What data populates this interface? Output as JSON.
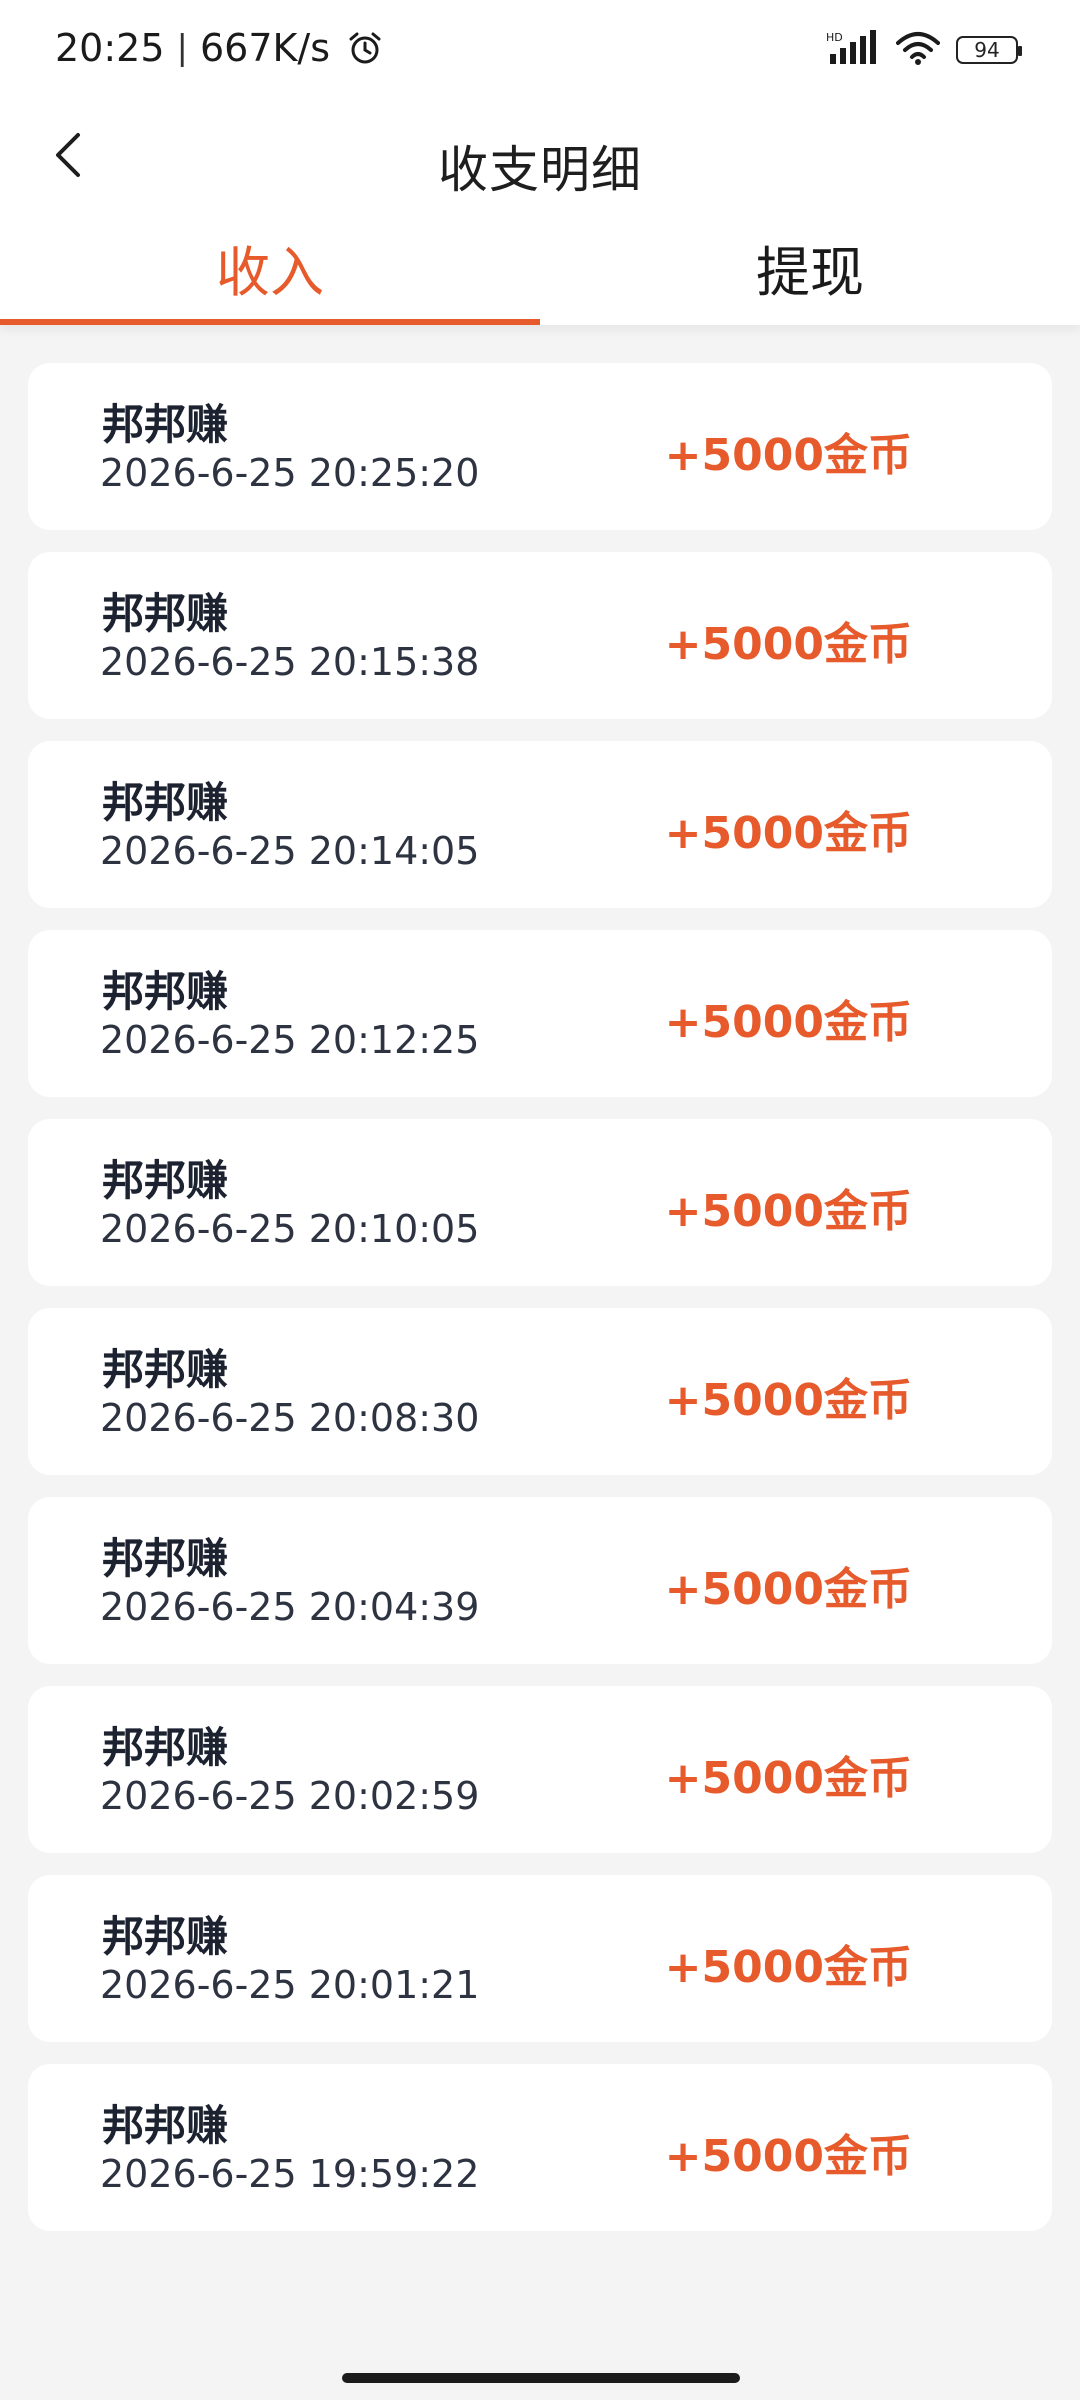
{
  "status_bar": {
    "time": "20:25",
    "separator": "|",
    "network_speed": "667K/s",
    "battery_level": "94",
    "alarm_icon": "alarm-clock-icon",
    "signal_icon": "signal-icon",
    "wifi_icon": "wifi-icon",
    "hd_label": "HD"
  },
  "header": {
    "title": "收支明细",
    "back_icon": "chevron-left-icon"
  },
  "tabs": [
    {
      "label": "收入",
      "active": true
    },
    {
      "label": "提现",
      "active": false
    }
  ],
  "colors": {
    "accent": "#e65a2b",
    "background": "#f4f4f4",
    "card": "#ffffff",
    "text_primary": "#1c2230"
  },
  "records": [
    {
      "source": "邦邦赚",
      "time": "2026-6-25 20:25:20",
      "amount": "+5000金币"
    },
    {
      "source": "邦邦赚",
      "time": "2026-6-25 20:15:38",
      "amount": "+5000金币"
    },
    {
      "source": "邦邦赚",
      "time": "2026-6-25 20:14:05",
      "amount": "+5000金币"
    },
    {
      "source": "邦邦赚",
      "time": "2026-6-25 20:12:25",
      "amount": "+5000金币"
    },
    {
      "source": "邦邦赚",
      "time": "2026-6-25 20:10:05",
      "amount": "+5000金币"
    },
    {
      "source": "邦邦赚",
      "time": "2026-6-25 20:08:30",
      "amount": "+5000金币"
    },
    {
      "source": "邦邦赚",
      "time": "2026-6-25 20:04:39",
      "amount": "+5000金币"
    },
    {
      "source": "邦邦赚",
      "time": "2026-6-25 20:02:59",
      "amount": "+5000金币"
    },
    {
      "source": "邦邦赚",
      "time": "2026-6-25 20:01:21",
      "amount": "+5000金币"
    },
    {
      "source": "邦邦赚",
      "time": "2026-6-25 19:59:22",
      "amount": "+5000金币"
    }
  ]
}
